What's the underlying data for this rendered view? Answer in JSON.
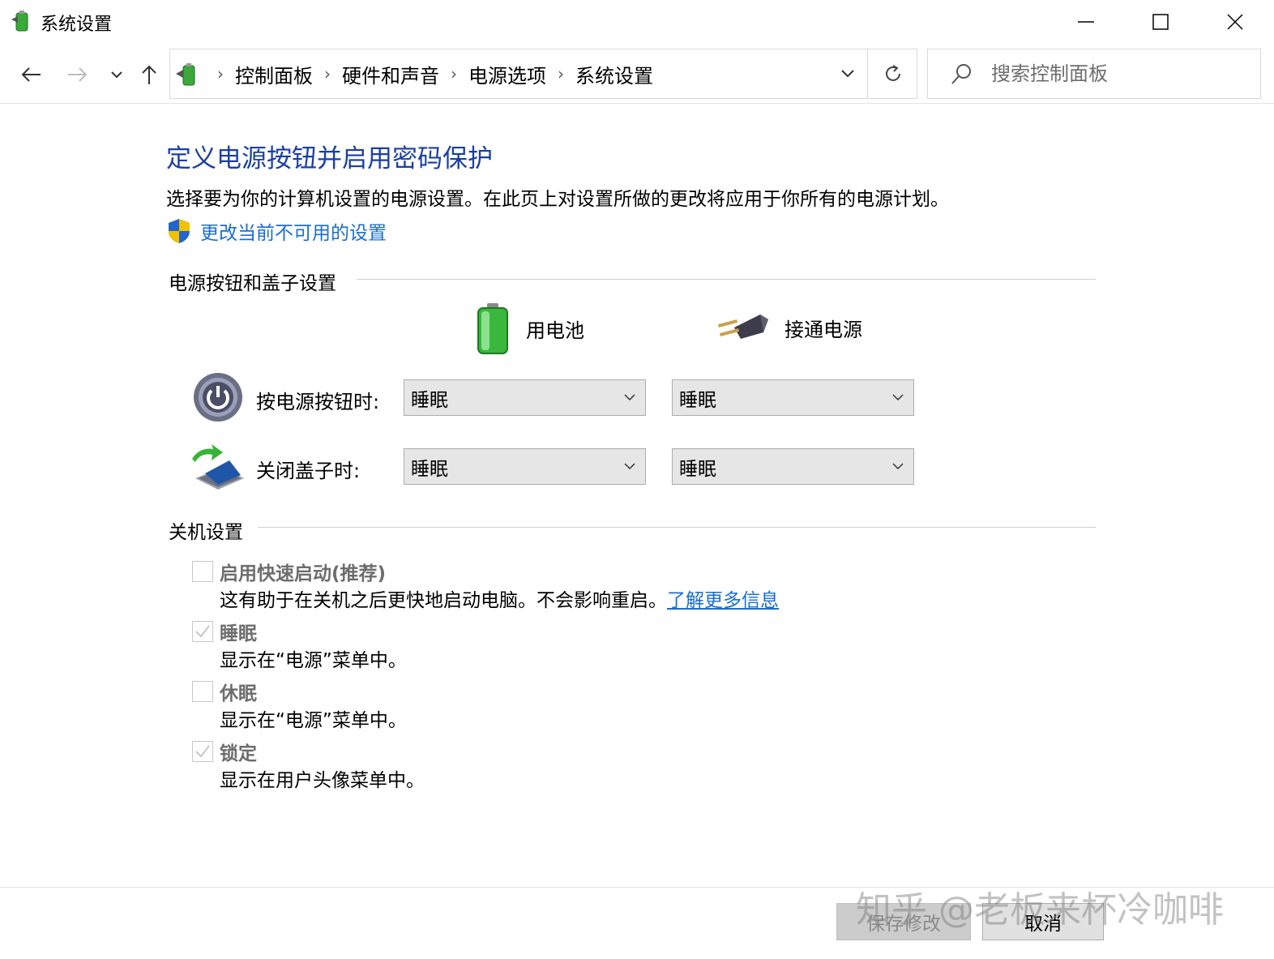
{
  "window": {
    "title": "系统设置",
    "app_icon": "power-options-icon"
  },
  "nav": {
    "breadcrumbs": [
      "控制面板",
      "硬件和声音",
      "电源选项",
      "系统设置"
    ],
    "search_placeholder": "搜索控制面板"
  },
  "page": {
    "heading": "定义电源按钮并启用密码保护",
    "description": "选择要为你的计算机设置的电源设置。在此页上对设置所做的更改将应用于你所有的电源计划。",
    "uac_link": "更改当前不可用的设置"
  },
  "power_section": {
    "title": "电源按钮和盖子设置",
    "col_battery": "用电池",
    "col_plugged": "接通电源",
    "rows": [
      {
        "label": "按电源按钮时:",
        "battery": "睡眠",
        "plugged": "睡眠"
      },
      {
        "label": "关闭盖子时:",
        "battery": "睡眠",
        "plugged": "睡眠"
      }
    ]
  },
  "shutdown_section": {
    "title": "关机设置",
    "options": [
      {
        "title": "启用快速启动(推荐)",
        "desc": "这有助于在关机之后更快地启动电脑。不会影响重启。",
        "link": "了解更多信息",
        "checked": false
      },
      {
        "title": "睡眠",
        "desc": "显示在“电源”菜单中。",
        "checked": true
      },
      {
        "title": "休眠",
        "desc": "显示在“电源”菜单中。",
        "checked": false
      },
      {
        "title": "锁定",
        "desc": "显示在用户头像菜单中。",
        "checked": true
      }
    ]
  },
  "footer": {
    "save": "保存修改",
    "cancel": "取消"
  },
  "watermark": "知乎 @老板来杯冷咖啡",
  "colors": {
    "heading": "#1a3fa3",
    "link": "#1a6ed1",
    "disabled_text": "#6d6d6d"
  }
}
